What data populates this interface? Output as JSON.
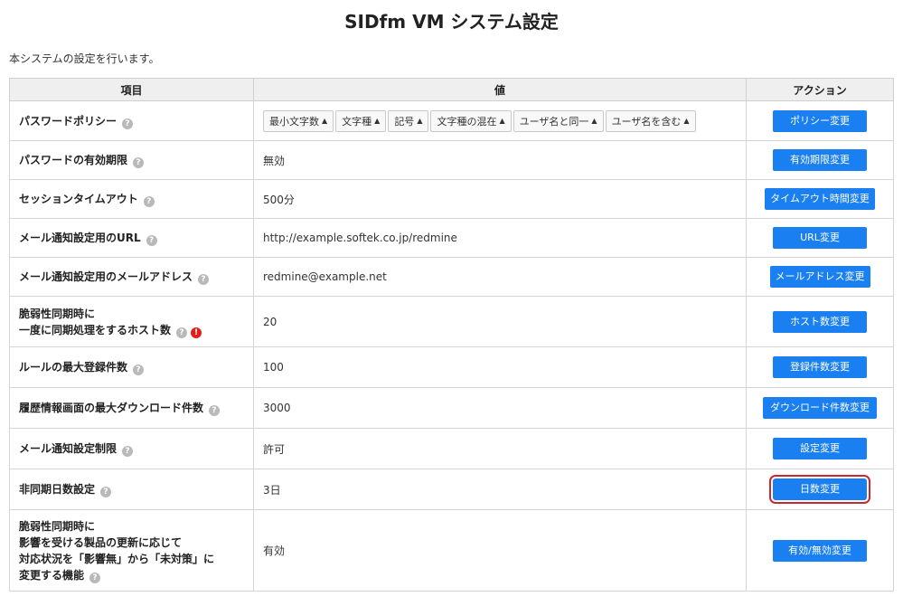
{
  "page": {
    "title": "SIDfm VM システム設定",
    "description": "本システムの設定を行います。"
  },
  "table": {
    "headers": {
      "item": "項目",
      "value": "値",
      "action": "アクション"
    },
    "rows": [
      {
        "item_lines": [
          "パスワードポリシー"
        ],
        "value": "",
        "action": "ポリシー変更"
      },
      {
        "item_lines": [
          "パスワードの有効期限"
        ],
        "value": "無効",
        "action": "有効期限変更"
      },
      {
        "item_lines": [
          "セッションタイムアウト"
        ],
        "value": "500分",
        "action": "タイムアウト時間変更"
      },
      {
        "item_lines": [
          "メール通知設定用のURL"
        ],
        "value": "http://example.softek.co.jp/redmine",
        "action": "URL変更"
      },
      {
        "item_lines": [
          "メール通知設定用のメールアドレス"
        ],
        "value": "redmine@example.net",
        "action": "メールアドレス変更"
      },
      {
        "item_lines": [
          "脆弱性同期時に",
          "一度に同期処理をするホスト数"
        ],
        "value": "20",
        "action": "ホスト数変更"
      },
      {
        "item_lines": [
          "ルールの最大登録件数"
        ],
        "value": "100",
        "action": "登録件数変更"
      },
      {
        "item_lines": [
          "履歴情報画面の最大ダウンロード件数"
        ],
        "value": "3000",
        "action": "ダウンロード件数変更"
      },
      {
        "item_lines": [
          "メール通知設定制限"
        ],
        "value": "許可",
        "action": "設定変更"
      },
      {
        "item_lines": [
          "非同期日数設定"
        ],
        "value": "3日",
        "action": "日数変更"
      },
      {
        "item_lines": [
          "脆弱性同期時に",
          "影響を受ける製品の更新に応じて",
          "対応状況を「影響無」から「未対策」に",
          "変更する機能"
        ],
        "value": "有効",
        "action": "有効/無効変更"
      }
    ],
    "policy_options": [
      "最小文字数",
      "文字種",
      "記号",
      "文字種の混在",
      "ユーザ名と同一",
      "ユーザ名を含む"
    ]
  },
  "icons": {
    "help": "?",
    "warning": "!"
  },
  "colors": {
    "button": "#1a7ff0",
    "highlight": "#c9282d",
    "warning": "#e0201b"
  }
}
